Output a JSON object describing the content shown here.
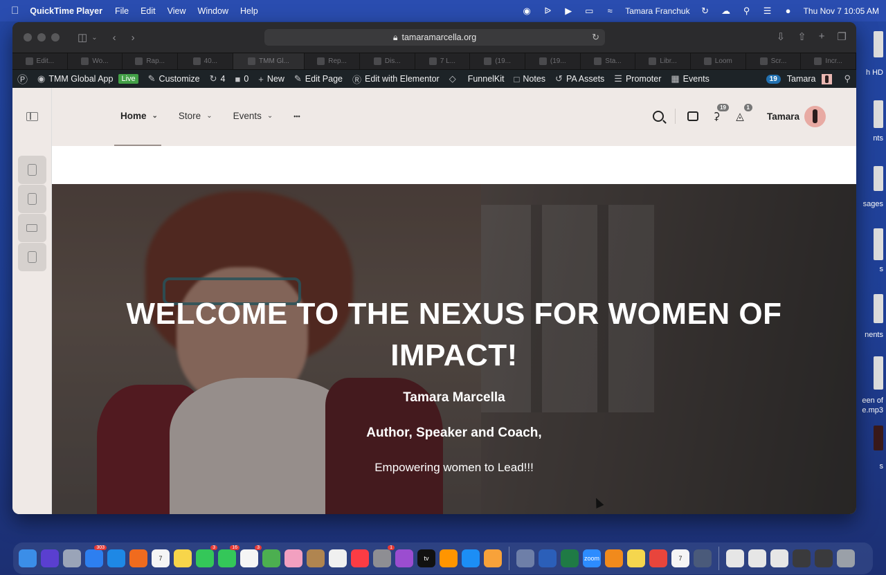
{
  "menubar": {
    "app_name": "QuickTime Player",
    "menus": [
      "File",
      "Edit",
      "View",
      "Window",
      "Help"
    ],
    "user": "Tamara Franchuk",
    "datetime": "Thu Nov 7  10:05 AM"
  },
  "desktop": {
    "labels": [
      "h HD",
      "nts",
      "sages",
      "s",
      "nents",
      "een of",
      "e.mp3",
      "s"
    ]
  },
  "browser": {
    "url": "tamaramarcella.org",
    "tabs": [
      {
        "label": "Edit..."
      },
      {
        "label": "Wo..."
      },
      {
        "label": "Rap..."
      },
      {
        "label": "40..."
      },
      {
        "label": "TMM Gl...",
        "active": true
      },
      {
        "label": "Rep..."
      },
      {
        "label": "Dis..."
      },
      {
        "label": "7 L..."
      },
      {
        "label": "(19..."
      },
      {
        "label": "(19..."
      },
      {
        "label": "Sta..."
      },
      {
        "label": "Libr..."
      },
      {
        "label": "Loom"
      },
      {
        "label": "Scr..."
      },
      {
        "label": "Incr..."
      }
    ]
  },
  "adminbar": {
    "site": "TMM Global App",
    "live": "Live",
    "customize": "Customize",
    "updates": "4",
    "comments": "0",
    "new": "New",
    "edit_page": "Edit Page",
    "elementor": "Edit with Elementor",
    "funnelkit": "FunnelKit",
    "notes": "Notes",
    "pa_assets": "PA Assets",
    "promoter": "Promoter",
    "events": "Events",
    "notif_count": "19",
    "user": "Tamara"
  },
  "site_header": {
    "nav": [
      "Home",
      "Store",
      "Events"
    ],
    "more": "•••",
    "notif_count": "19",
    "cart_count": "1",
    "user": "Tamara"
  },
  "hero": {
    "title": "WELCOME TO THE NEXUS FOR WOMEN OF IMPACT!",
    "name": "Tamara Marcella",
    "role": "Author, Speaker and Coach,",
    "tagline": "Empowering women to Lead!!!"
  },
  "dock": {
    "apps": [
      {
        "name": "Finder",
        "color": "#3b8ee8"
      },
      {
        "name": "Siri",
        "color": "#5a3fd0"
      },
      {
        "name": "Launchpad",
        "color": "#9aa4b8"
      },
      {
        "name": "Mail",
        "color": "#2d7ff0",
        "badge": "303"
      },
      {
        "name": "Safari",
        "color": "#1e88e5"
      },
      {
        "name": "Firefox",
        "color": "#f06b1e"
      },
      {
        "name": "Calendar",
        "color": "#f5f5f5",
        "text": "7"
      },
      {
        "name": "Notes",
        "color": "#f7d54a"
      },
      {
        "name": "FaceTime",
        "color": "#34c759",
        "badge": "3"
      },
      {
        "name": "Messages",
        "color": "#34c759",
        "badge": "16"
      },
      {
        "name": "Reminders",
        "color": "#f5f5f5",
        "badge": "3"
      },
      {
        "name": "Maps",
        "color": "#4caf50"
      },
      {
        "name": "Photos",
        "color": "#f2a0c0"
      },
      {
        "name": "Contacts",
        "color": "#b08550"
      },
      {
        "name": "News",
        "color": "#f0f0f0"
      },
      {
        "name": "Music",
        "color": "#fc3c44"
      },
      {
        "name": "System Settings",
        "color": "#8e8e93",
        "badge": "1"
      },
      {
        "name": "Podcasts",
        "color": "#9b4dd0"
      },
      {
        "name": "TV",
        "color": "#111111",
        "text": "tv"
      },
      {
        "name": "Books",
        "color": "#ff9500"
      },
      {
        "name": "App Store",
        "color": "#1c8ef5"
      },
      {
        "name": "Pages",
        "color": "#f8a23a"
      },
      {
        "name": "Preview",
        "color": "#6e7fa8"
      },
      {
        "name": "Word",
        "color": "#2b5fb9"
      },
      {
        "name": "Excel",
        "color": "#1f7a45"
      },
      {
        "name": "Zoom",
        "color": "#2d8cff",
        "text": "zoom"
      },
      {
        "name": "VLC",
        "color": "#f18a1c"
      },
      {
        "name": "Stickies",
        "color": "#f5d64e"
      },
      {
        "name": "Chrome",
        "color": "#e8453c"
      },
      {
        "name": "Calendar 2",
        "color": "#f5f5f5",
        "text": "7"
      },
      {
        "name": "QuickTime",
        "color": "#4a5a7a"
      },
      {
        "name": "Doc 1",
        "color": "#e6e6e6"
      },
      {
        "name": "Doc 2",
        "color": "#e6e6e6"
      },
      {
        "name": "Doc 3",
        "color": "#e6e6e6"
      },
      {
        "name": "Doc 4",
        "color": "#3a3a3c"
      },
      {
        "name": "Doc 5",
        "color": "#3a3a3c"
      },
      {
        "name": "Trash",
        "color": "#9aa0a8"
      }
    ]
  }
}
